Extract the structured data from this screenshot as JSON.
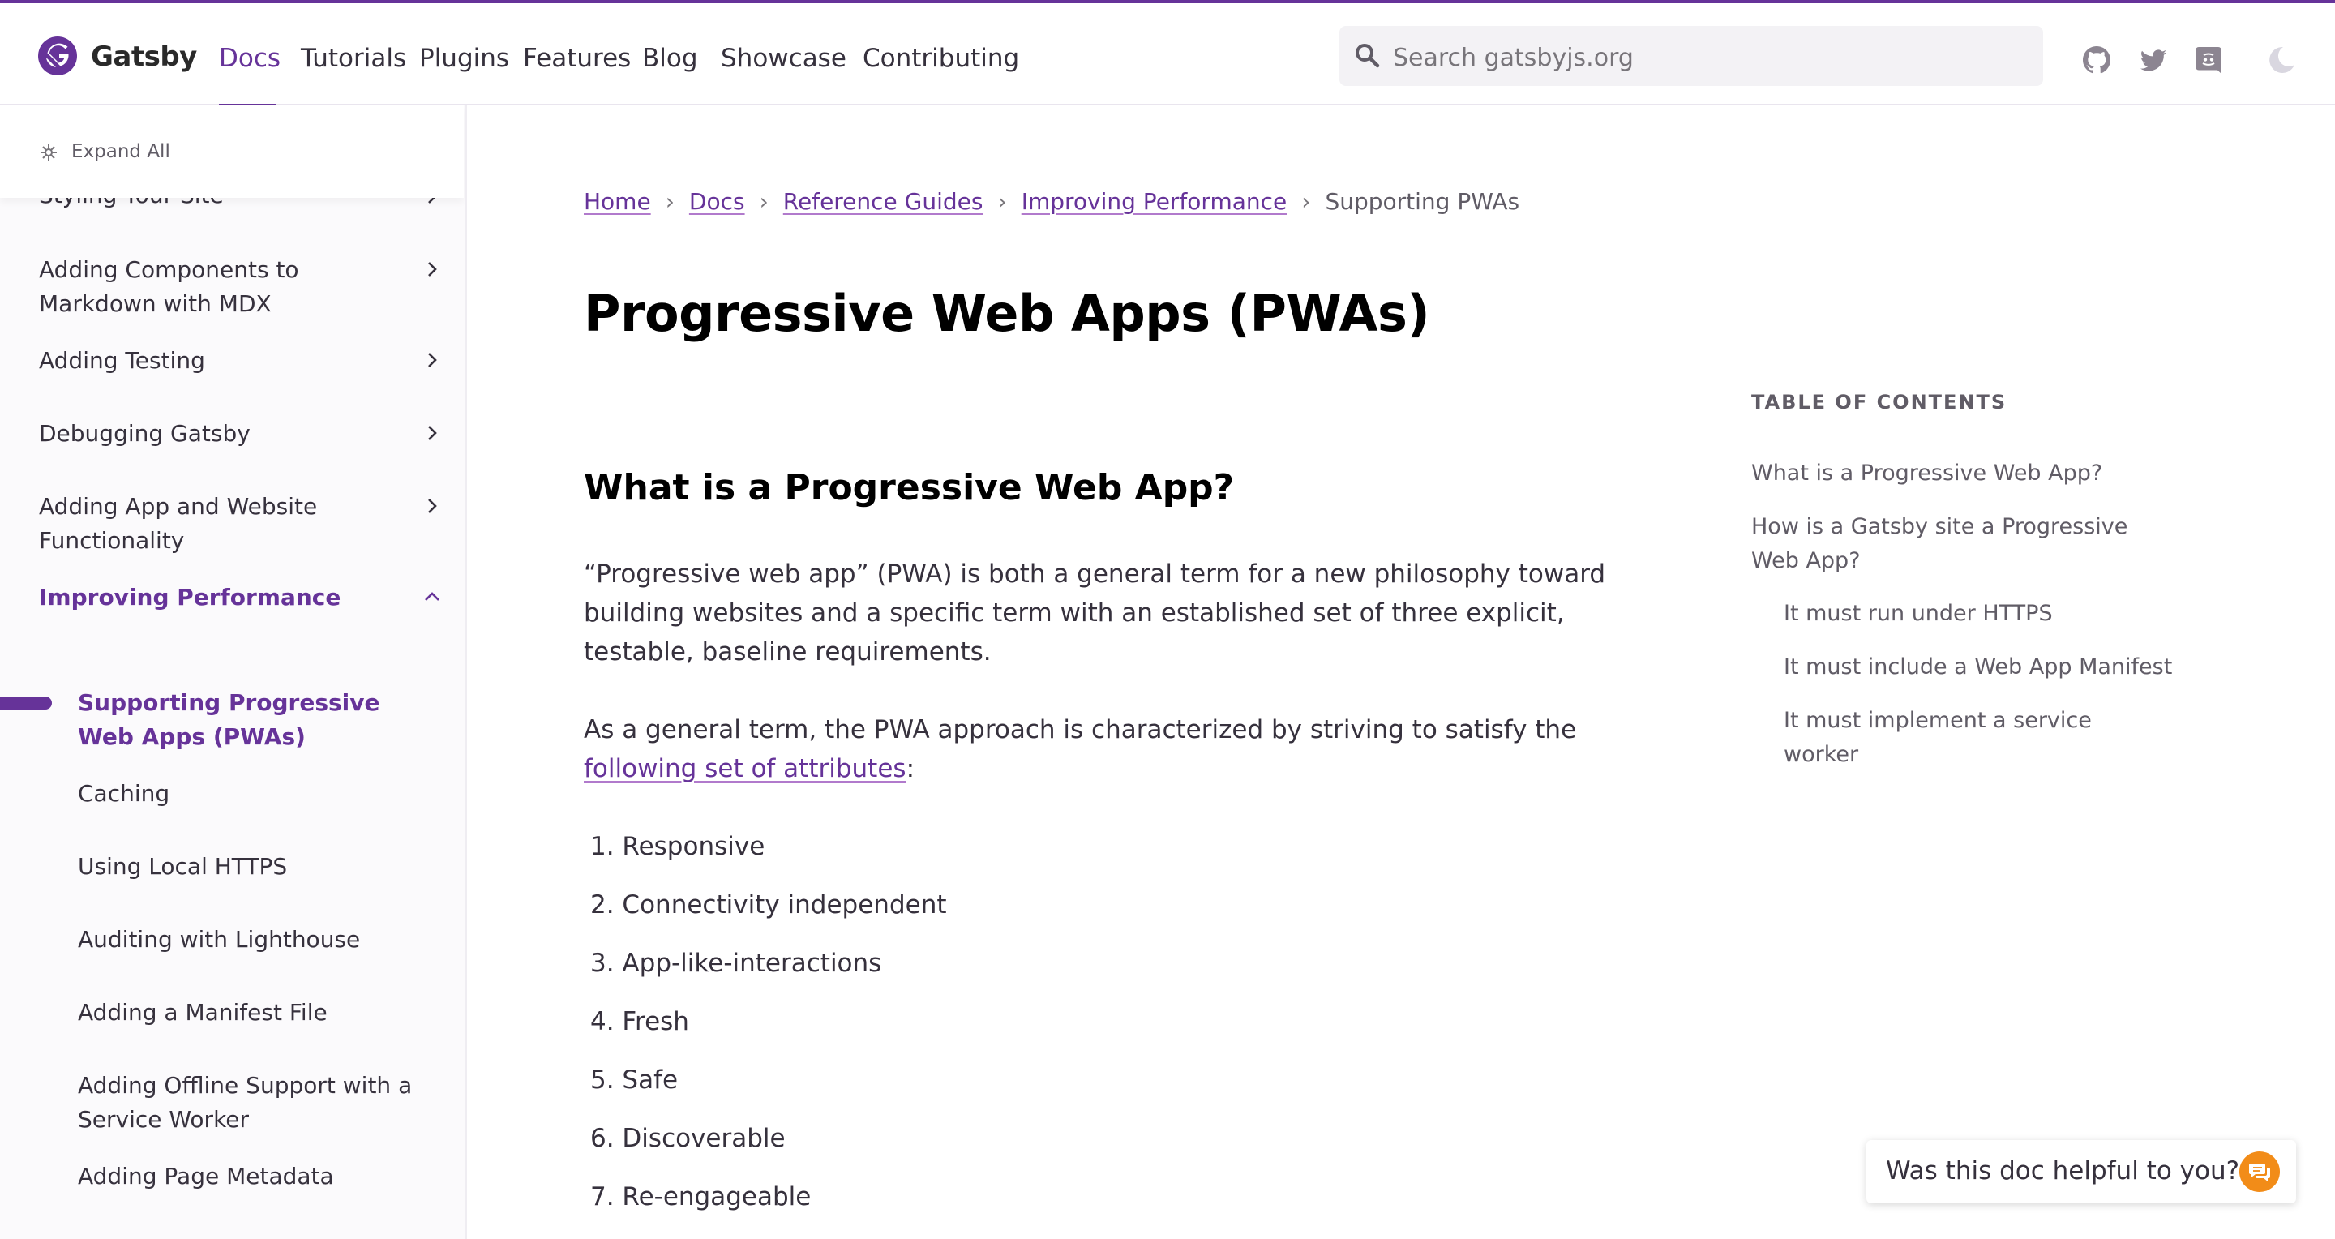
{
  "brand": {
    "name": "Gatsby",
    "accent": "#663399",
    "feedback_color": "#f28c18"
  },
  "nav": {
    "items": [
      "Docs",
      "Tutorials",
      "Plugins",
      "Features",
      "Blog",
      "Showcase",
      "Contributing"
    ],
    "active": "Docs"
  },
  "search": {
    "placeholder": "Search gatsbyjs.org"
  },
  "header_icons": [
    "github-icon",
    "twitter-icon",
    "discord-icon",
    "dark-mode-icon"
  ],
  "sidebar": {
    "expand_all": "Expand All",
    "items": [
      {
        "label": "Styling Your Site",
        "chevron": "right"
      },
      {
        "label": "Adding Components to Markdown with MDX",
        "chevron": "right"
      },
      {
        "label": "Adding Testing",
        "chevron": "right"
      },
      {
        "label": "Debugging Gatsby",
        "chevron": "right"
      },
      {
        "label": "Adding App and Website Functionality",
        "chevron": "right"
      },
      {
        "label": "Improving Performance",
        "chevron": "up"
      }
    ],
    "subitems": [
      "Supporting Progressive Web Apps (PWAs)",
      "Caching",
      "Using Local HTTPS",
      "Auditing with Lighthouse",
      "Adding a Manifest File",
      "Adding Offline Support with a Service Worker",
      "Adding Page Metadata"
    ]
  },
  "breadcrumb": {
    "links": [
      "Home",
      "Docs",
      "Reference Guides",
      "Improving Performance"
    ],
    "current": "Supporting PWAs"
  },
  "article": {
    "title": "Progressive Web Apps (PWAs)",
    "h2": "What is a Progressive Web App?",
    "p1": "“Progressive web app” (PWA) is both a general term for a new philosophy toward building websites and a specific term with an established set of three explicit, testable, baseline requirements.",
    "p2_before": "As a general term, the PWA approach is characterized by striving to satisfy the ",
    "p2_link": "following set of attributes",
    "p2_after": ":",
    "list": [
      "1. Responsive",
      "2. Connectivity independent",
      "3. App-like-interactions",
      "4. Fresh",
      "5. Safe",
      "6. Discoverable",
      "7. Re-engageable"
    ]
  },
  "toc": {
    "title": "TABLE OF CONTENTS",
    "items": [
      "What is a Progressive Web App?",
      "How is a Gatsby site a Progressive Web App?",
      "It must run under HTTPS",
      "It must include a Web App Manifest",
      "It must implement a service worker"
    ]
  },
  "feedback": {
    "label": "Was this doc helpful to you?"
  }
}
